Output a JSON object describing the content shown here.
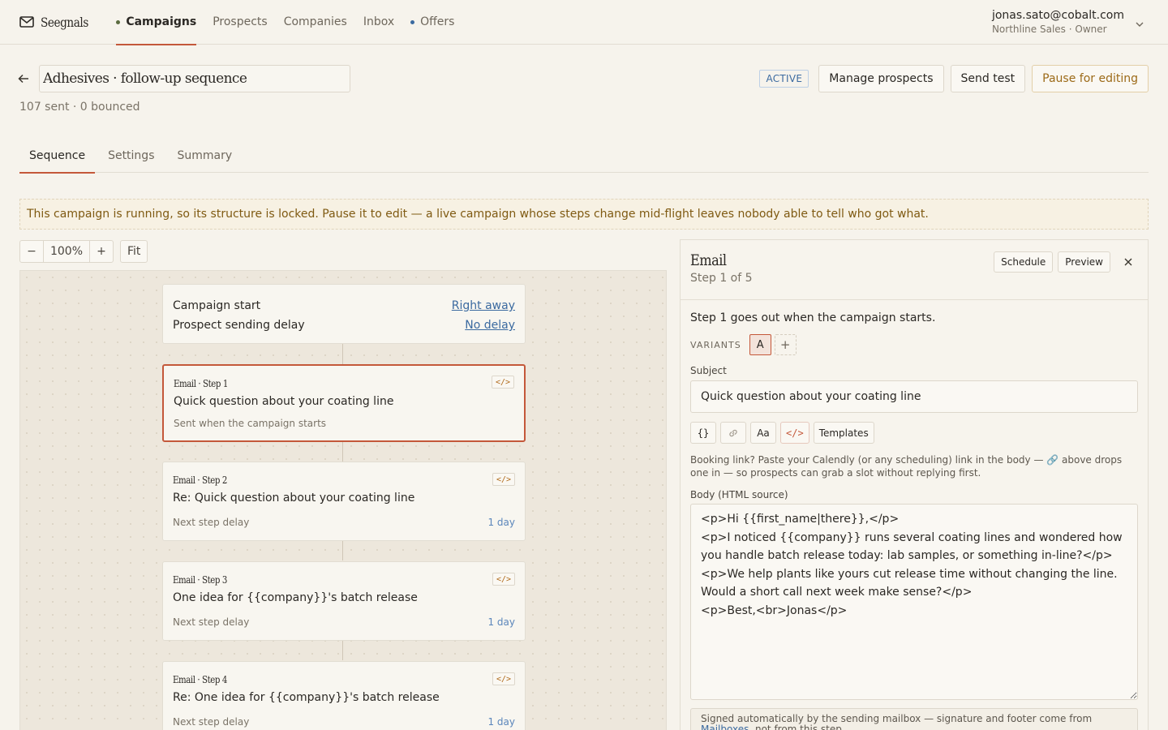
{
  "nav": {
    "brand": "Seegnals",
    "brand_icon": "mail-icon",
    "items": [
      {
        "label": "Campaigns",
        "active": true,
        "dot": "#5b6b3f"
      },
      {
        "label": "Prospects"
      },
      {
        "label": "Companies"
      },
      {
        "label": "Inbox"
      },
      {
        "label": "Offers",
        "dot": "#3b6aa0"
      }
    ],
    "account": {
      "email": "jonas.sato@cobalt.com",
      "org": "Northline Sales · Owner"
    }
  },
  "header": {
    "back_icon": "arrow-left-icon",
    "campaign_name": "Adhesives · follow-up sequence",
    "stats": "107 sent · 0 bounced",
    "status": "ACTIVE",
    "buttons": {
      "manage": "Manage prospects",
      "send_test": "Send test",
      "pause": "Pause for editing"
    }
  },
  "tabs": [
    {
      "label": "Sequence",
      "active": true
    },
    {
      "label": "Settings"
    },
    {
      "label": "Summary"
    }
  ],
  "notice": "This campaign is running, so its structure is locked. Pause it to edit — a live campaign whose steps change mid-flight leaves nobody able to tell who got what.",
  "zoom": {
    "minus": "−",
    "value": "100%",
    "plus": "+",
    "fit": "Fit"
  },
  "canvas": {
    "start": {
      "campaign_start_label": "Campaign start",
      "campaign_start_value": "Right away",
      "delay_label": "Prospect sending delay",
      "delay_value": "No delay"
    },
    "steps": [
      {
        "label": "Email · Step 1",
        "subject": "Quick question about your coating line",
        "footer_left": "Sent when the campaign starts",
        "footer_right": ""
      },
      {
        "label": "Email · Step 2",
        "subject": "Re: Quick question about your coating line",
        "footer_left": "Next step delay",
        "footer_right": "1 day"
      },
      {
        "label": "Email · Step 3",
        "subject": "One idea for {{company}}'s batch release",
        "footer_left": "Next step delay",
        "footer_right": "1 day"
      },
      {
        "label": "Email · Step 4",
        "subject": "Re: One idea for {{company}}'s batch release",
        "footer_left": "Next step delay",
        "footer_right": "1 day"
      }
    ],
    "code_chip": "</>"
  },
  "panel": {
    "title": "Email",
    "subtitle": "Step 1 of 5",
    "buttons": {
      "schedule": "Schedule",
      "preview": "Preview"
    },
    "close_icon": "close-icon",
    "intro": "Step 1 goes out when the campaign starts.",
    "variants_label": "VARIANTS",
    "variant_a": "A",
    "variant_add": "+",
    "subject_label": "Subject",
    "subject_value": "Quick question about your coating line",
    "toolbar": {
      "vars": "{}",
      "link_icon": "link-icon",
      "font": "Aa",
      "code": "</>",
      "templates": "Templates"
    },
    "tip": "Booking link? Paste your Calendly (or any scheduling) link in the body — 🔗 above drops one in — so prospects can grab a slot without replying first.",
    "body_label": "Body (HTML source)",
    "body_value": "<p>Hi {{first_name|there}},</p>\n<p>I noticed {{company}} runs several coating lines and wondered how you handle batch release today: lab samples, or something in-line?</p>\n<p>We help plants like yours cut release time without changing the line. Would a short call next week make sense?</p>\n<p>Best,<br>Jonas</p>",
    "signed_text": "Signed automatically by the sending mailbox — signature and footer come from",
    "signed_link": "Mailboxes",
    "signed_tail": ", not from this step."
  }
}
